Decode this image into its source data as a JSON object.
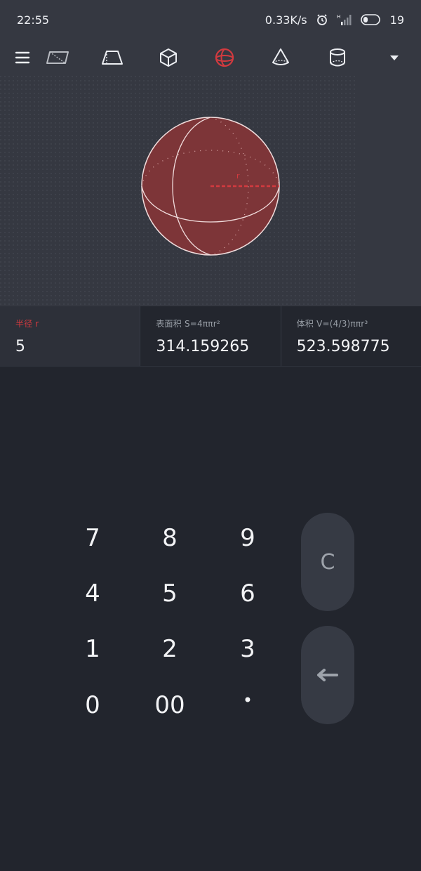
{
  "status_bar": {
    "time": "22:55",
    "net_speed": "0.33K/s",
    "battery_level": "19"
  },
  "toolbar": {
    "icons": [
      "menu-icon",
      "parallelogram-icon",
      "trapezoid-icon",
      "cube-icon",
      "sphere-icon",
      "cone-icon",
      "cylinder-icon",
      "dropdown-icon"
    ],
    "selected": "sphere-icon",
    "accent_color": "#d33a3f"
  },
  "figure": {
    "radius_label": "r",
    "fill_color": "#7d3538"
  },
  "values": {
    "radius": {
      "label": "半径 r",
      "value": "5"
    },
    "surface_area": {
      "label": "表面积 S=4ππr²",
      "value": "314.159265"
    },
    "volume": {
      "label": "体积 V=(4/3)ππr³",
      "value": "523.598775"
    }
  },
  "keypad": {
    "keys": {
      "k7": "7",
      "k8": "8",
      "k9": "9",
      "k4": "4",
      "k5": "5",
      "k6": "6",
      "k1": "1",
      "k2": "2",
      "k3": "3",
      "k0": "0",
      "k00": "00",
      "dot": "•"
    },
    "clear": "C"
  }
}
